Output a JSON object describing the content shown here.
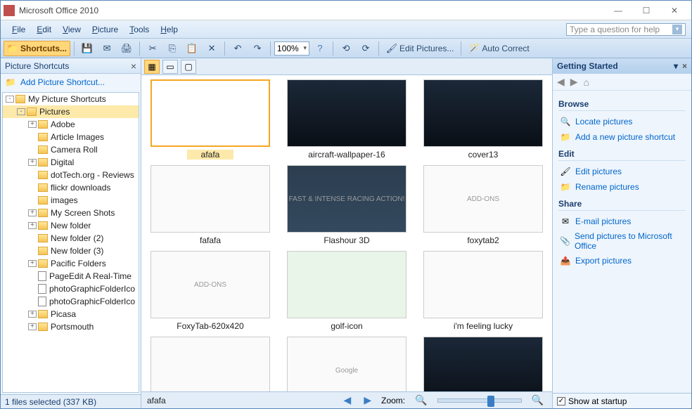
{
  "title": "Microsoft Office 2010",
  "menus": [
    "File",
    "Edit",
    "View",
    "Picture",
    "Tools",
    "Help"
  ],
  "help_placeholder": "Type a question for help",
  "toolbar": {
    "shortcuts": "Shortcuts...",
    "zoom": "100%",
    "edit_pictures": "Edit Pictures...",
    "auto_correct": "Auto Correct"
  },
  "left": {
    "header": "Picture Shortcuts",
    "add": "Add Picture Shortcut...",
    "root": "My Picture Shortcuts",
    "selected": "Pictures",
    "folders": [
      {
        "t": "+",
        "n": "Adobe"
      },
      {
        "t": "",
        "n": "Article Images"
      },
      {
        "t": "",
        "n": "Camera Roll"
      },
      {
        "t": "+",
        "n": "Digital"
      },
      {
        "t": "",
        "n": "dotTech.org - Reviews"
      },
      {
        "t": "",
        "n": "flickr downloads"
      },
      {
        "t": "",
        "n": "images"
      },
      {
        "t": "+",
        "n": "My Screen Shots"
      },
      {
        "t": "+",
        "n": "New folder"
      },
      {
        "t": "",
        "n": "New folder (2)"
      },
      {
        "t": "",
        "n": "New folder (3)"
      },
      {
        "t": "+",
        "n": "Pacific Folders"
      },
      {
        "t": "",
        "n": "PageEdit  A Real-Time",
        "file": true
      },
      {
        "t": "",
        "n": "photoGraphicFolderIco",
        "file": true
      },
      {
        "t": "",
        "n": "photoGraphicFolderIco",
        "file": true
      },
      {
        "t": "+",
        "n": "Picasa"
      },
      {
        "t": "+",
        "n": "Portsmouth"
      }
    ],
    "status": "1 files selected (337 KB)"
  },
  "thumbs": [
    {
      "n": "afafa",
      "sel": true,
      "cls": ""
    },
    {
      "n": "aircraft-wallpaper-16",
      "cls": "img-dark"
    },
    {
      "n": "cover13",
      "cls": "img-dark"
    },
    {
      "n": "fafafa",
      "cls": "img-light"
    },
    {
      "n": "Flashour 3D",
      "cls": "img-game",
      "txt": "FAST & INTENSE RACING ACTION!"
    },
    {
      "n": "foxytab2",
      "cls": "img-light",
      "txt": "ADD-ONS"
    },
    {
      "n": "FoxyTab-620x420",
      "cls": "img-light",
      "txt": "ADD-ONS"
    },
    {
      "n": "golf-icon",
      "cls": "img-golf"
    },
    {
      "n": "i'm feeling lucky",
      "cls": "img-light"
    },
    {
      "n": "",
      "cls": "img-light"
    },
    {
      "n": "",
      "cls": "img-light",
      "txt": "Google"
    },
    {
      "n": "",
      "cls": "img-dark"
    }
  ],
  "centerbar": {
    "name": "afafa",
    "zoom_label": "Zoom:"
  },
  "right": {
    "header": "Getting Started",
    "sections": {
      "browse": "Browse",
      "edit": "Edit",
      "share": "Share"
    },
    "links": {
      "locate": "Locate pictures",
      "add_shortcut": "Add a new picture shortcut",
      "edit_pics": "Edit pictures",
      "rename": "Rename pictures",
      "email": "E-mail pictures",
      "send_office": "Send pictures to Microsoft Office",
      "export": "Export pictures"
    },
    "footer": "Show at startup"
  }
}
